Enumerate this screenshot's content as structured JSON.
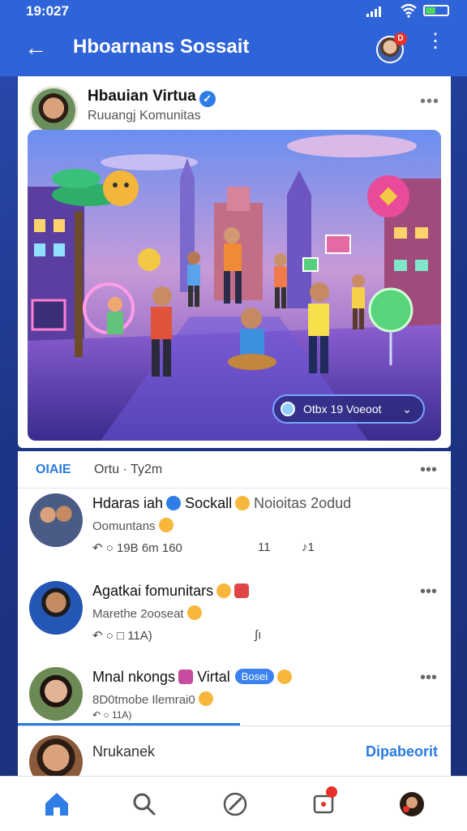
{
  "status_bar": {
    "time": "19:027"
  },
  "header": {
    "title": "Hboarnans Sossait",
    "avatar_badge": "D"
  },
  "card": {
    "title": "Hbauian Virtua",
    "subtitle": "Ruuangj Komunitas",
    "hero_pill": "Otbx 19 Voeoot"
  },
  "feed": {
    "tag": "OIAIE",
    "sort": "Ortu · Ty2m",
    "posts": [
      {
        "name": "Hdaras iah",
        "name_extra": "Sockall",
        "name_muted": "Noioitas 2odud",
        "sub": "Oomuntans",
        "meta": "↶  ○ 19B  6m 160",
        "m2": "11",
        "m3": "♪1"
      },
      {
        "name": "Agatkai fomunitars",
        "sub": "Marethe 2ooseat",
        "meta": "↶  ○ □  11A)",
        "m3": "∫ı"
      },
      {
        "name": "Mnal nkongs",
        "name_extra": "Virtal",
        "pill": "Bosei",
        "sub": "8D0tmobe Ilemrai0",
        "meta": "↶  ○  11A)"
      }
    ]
  },
  "compose": {
    "placeholder": "Nrukanek",
    "action": "Dipabeorit"
  },
  "icons": {
    "nav": [
      "home-icon",
      "search-icon",
      "compose-icon",
      "notification-icon",
      "profile-icon"
    ]
  },
  "colors": {
    "brand": "#2f63d8",
    "accent": "#2a7be0"
  }
}
